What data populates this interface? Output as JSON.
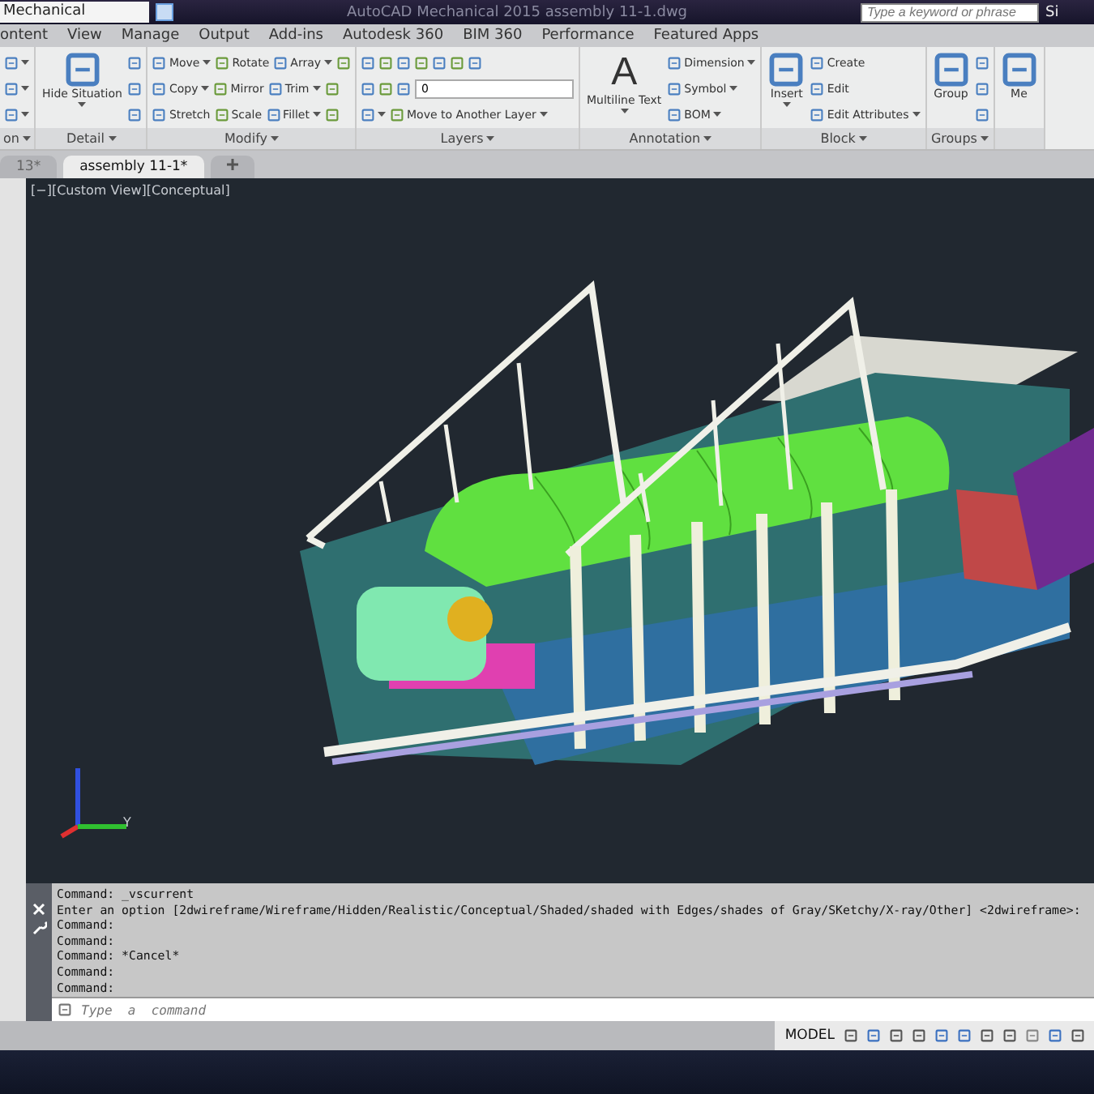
{
  "title_bar": {
    "workspace": "Mechanical",
    "title": "AutoCAD Mechanical 2015   assembly 11-1.dwg",
    "search_placeholder": "Type a keyword or phrase",
    "user": "Si"
  },
  "menu_tabs": [
    "ontent",
    "View",
    "Manage",
    "Output",
    "Add-ins",
    "Autodesk 360",
    "BIM 360",
    "Performance",
    "Featured Apps"
  ],
  "ribbon_panels": [
    {
      "title": "on",
      "rows": [
        [
          {
            "caret": true
          }
        ],
        [
          {
            "caret": true
          }
        ],
        [
          {
            "caret": true
          }
        ]
      ]
    },
    {
      "title": "Detail",
      "large": [
        {
          "label": "Hide Situation",
          "caret": true
        }
      ],
      "rows": [
        [
          {}
        ],
        [
          {}
        ],
        [
          {}
        ]
      ]
    },
    {
      "title": "Modify",
      "rows": [
        [
          {
            "label": "Move",
            "caret": true
          },
          {
            "label": "Rotate"
          },
          {
            "label": "Array",
            "caret": true
          },
          {}
        ],
        [
          {
            "label": "Copy",
            "caret": true
          },
          {
            "label": "Mirror"
          },
          {
            "label": "Trim",
            "caret": true
          },
          {}
        ],
        [
          {
            "label": "Stretch"
          },
          {
            "label": "Scale"
          },
          {
            "label": "Fillet",
            "caret": true
          },
          {}
        ]
      ]
    },
    {
      "title": "Layers",
      "rows": [
        [
          {},
          {},
          {},
          {},
          {},
          {},
          {}
        ],
        [
          {},
          {},
          {},
          {
            "kind": "dropdown",
            "label": "0"
          }
        ],
        [
          {
            "caret": true
          },
          {
            "label": "Move to Another Layer",
            "caret": true
          }
        ]
      ]
    },
    {
      "title": "Annotation",
      "large": [
        {
          "label": "Multiline Text",
          "glyph": "A",
          "caret": true
        }
      ],
      "rows": [
        [
          {
            "label": "Dimension",
            "caret": true
          }
        ],
        [
          {
            "label": "Symbol",
            "caret": true
          }
        ],
        [
          {
            "label": "BOM",
            "caret": true
          }
        ]
      ]
    },
    {
      "title": "Block",
      "large": [
        {
          "label": "Insert",
          "caret": true
        }
      ],
      "rows": [
        [
          {
            "label": "Create"
          }
        ],
        [
          {
            "label": "Edit"
          }
        ],
        [
          {
            "label": "Edit Attributes",
            "caret": true
          }
        ]
      ]
    },
    {
      "title": "Groups",
      "large": [
        {
          "label": "Group"
        }
      ],
      "rows": [
        [
          {}
        ],
        [
          {}
        ],
        [
          {}
        ]
      ]
    },
    {
      "large": [
        {
          "label": "Me"
        }
      ]
    }
  ],
  "doc_tabs": [
    {
      "label": "13*",
      "selected": false
    },
    {
      "label": "assembly 11-1*",
      "selected": true
    }
  ],
  "viewport": {
    "label": "[−][Custom View][Conceptual]",
    "axis_label": "Y"
  },
  "command_history": [
    "Command:  _vscurrent",
    "Enter an option [2dwireframe/Wireframe/Hidden/Realistic/Conceptual/Shaded/shaded with Edges/shades of Gray/SKetchy/X-ray/Other] <2dwireframe>:",
    "Command:",
    "Command:",
    "Command: *Cancel*",
    "Command:",
    "Command:"
  ],
  "command_input": {
    "placeholder": "Type  a  command"
  },
  "status_bar": {
    "space": "MODEL"
  }
}
